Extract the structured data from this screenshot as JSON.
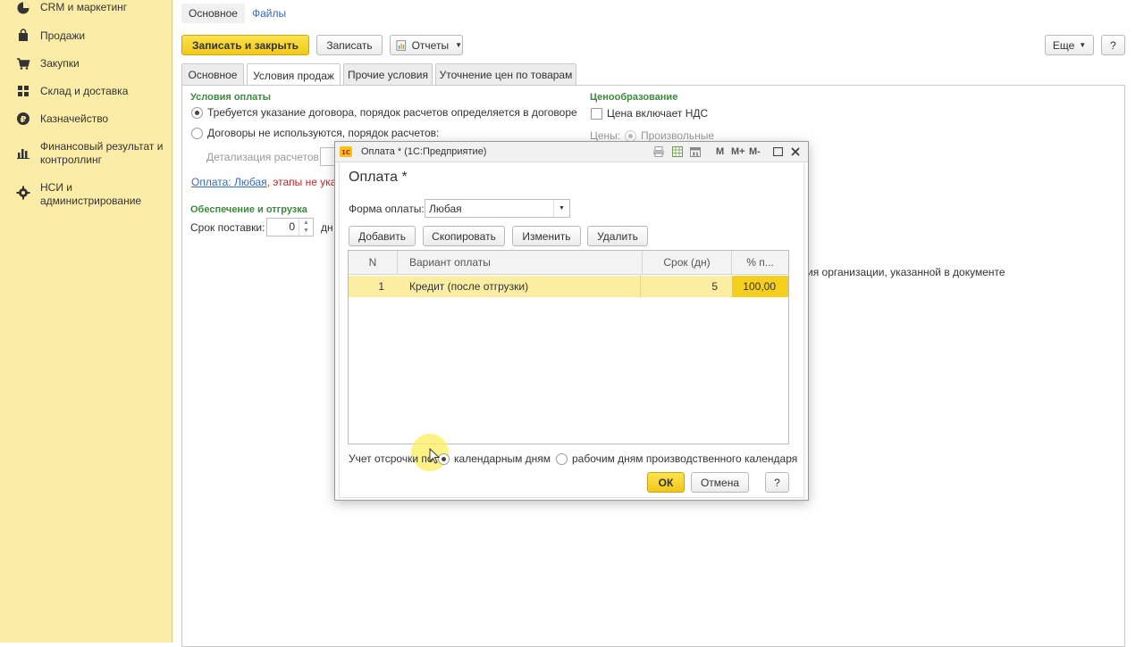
{
  "sidebar": {
    "items": [
      {
        "label": "CRM и маркетинг",
        "icon": "pie-chart-icon"
      },
      {
        "label": "Продажи",
        "icon": "bag-icon"
      },
      {
        "label": "Закупки",
        "icon": "cart-icon"
      },
      {
        "label": "Склад и доставка",
        "icon": "grid-icon"
      },
      {
        "label": "Казначейство",
        "icon": "ruble-icon"
      },
      {
        "label": "Финансовый результат и контроллинг",
        "icon": "bar-chart-icon"
      },
      {
        "label": "НСИ и администрирование",
        "icon": "gear-icon"
      }
    ]
  },
  "top_links": {
    "main": "Основное",
    "files": "Файлы"
  },
  "toolbar": {
    "save_close": "Записать и закрыть",
    "save": "Записать",
    "reports": "Отчеты",
    "more": "Еще",
    "help": "?"
  },
  "tabs": [
    "Основное",
    "Условия продаж",
    "Прочие условия",
    "Уточнение цен по товарам"
  ],
  "form": {
    "payment_terms_title": "Условия оплаты",
    "radio_contract": "Требуется указание договора, порядок расчетов определяется в договоре",
    "radio_no_contract": "Договоры не используются, порядок расчетов:",
    "detail_label": "Детализация расчетов:",
    "payment_link": "Оплата: Любая",
    "stages_text": ", этапы не указ",
    "shipping_title": "Обеспечение и отгрузка",
    "delivery_label": "Срок поставки:",
    "delivery_value": "0",
    "days_suffix": "дн",
    "pricing_title": "Ценообразование",
    "price_includes_vat": "Цена включает НДС",
    "prices_label": "Цены:",
    "prices_option": "Произвольные",
    "org_note": "ия организации, указанной в документе"
  },
  "modal": {
    "window_title": "Оплата * (1С:Предприятие)",
    "heading": "Оплата *",
    "form_label": "Форма оплаты:",
    "form_value": "Любая",
    "buttons": {
      "add": "Добавить",
      "copy": "Скопировать",
      "edit": "Изменить",
      "delete": "Удалить"
    },
    "columns": [
      "N",
      "Вариант оплаты",
      "Срок (дн)",
      "% п..."
    ],
    "rows": [
      {
        "n": "1",
        "variant": "Кредит (после отгрузки)",
        "term": "5",
        "percent": "100,00"
      }
    ],
    "deferral_label": "Учет отсрочки по",
    "opt_calendar": "календарным дням",
    "opt_work": "рабочим дням производственного календаря",
    "ok": "ОК",
    "cancel": "Отмена",
    "help": "?",
    "tb": {
      "m": "M",
      "m_plus": "M+",
      "m_minus": "M-"
    }
  },
  "colors": {
    "accent_yellow": "#f1c81a",
    "sidebar_bg": "#fbeca8",
    "section_green": "#3c8a3c",
    "link_blue": "#3b6bb6",
    "selected_row": "#fbeea3"
  }
}
